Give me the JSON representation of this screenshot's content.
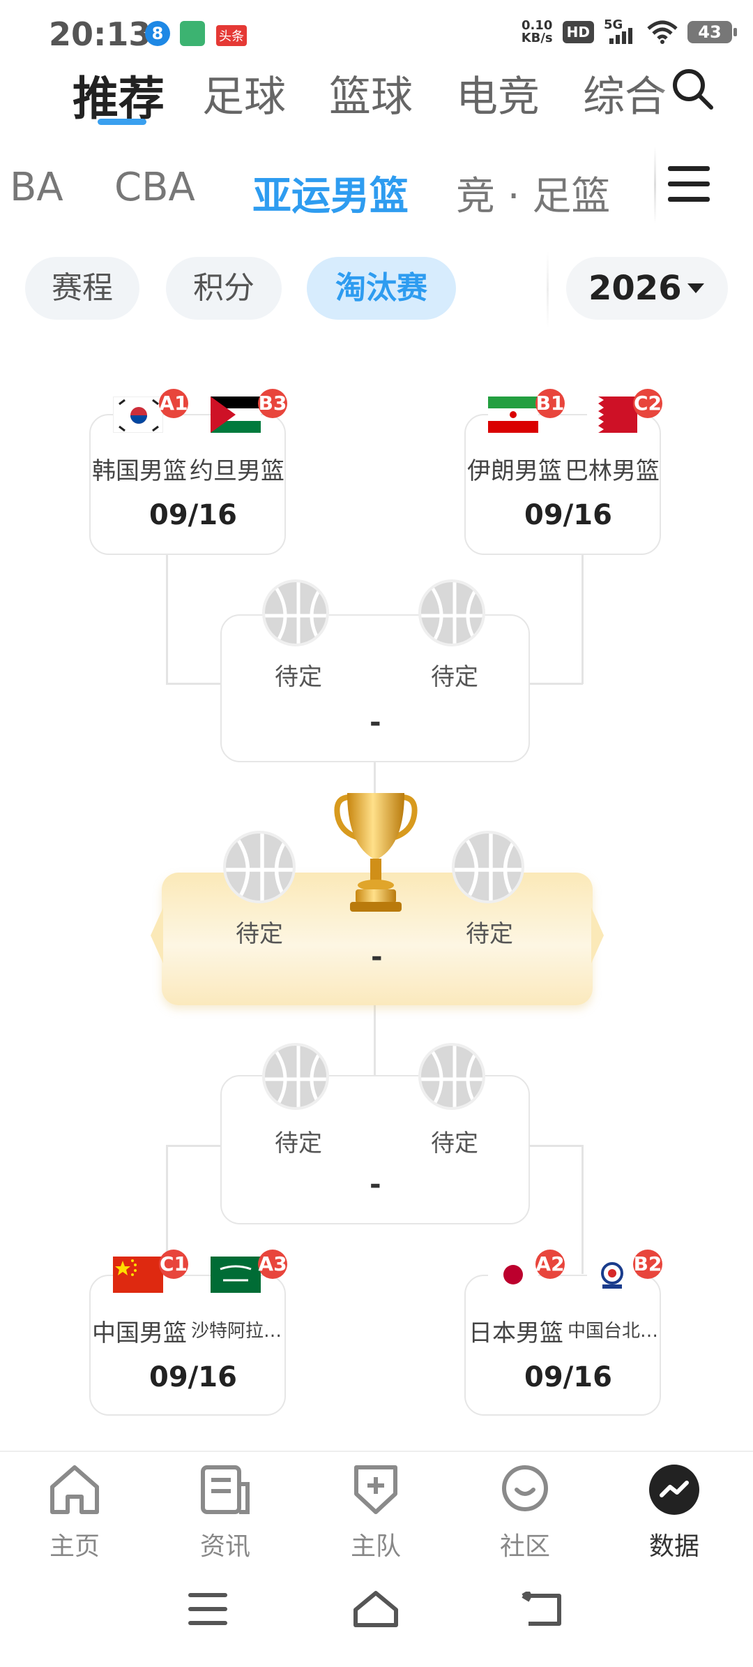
{
  "status_bar": {
    "time": "20:13",
    "net_speed": "0.10",
    "net_unit": "KB/s",
    "hd": "HD",
    "signal": "5G",
    "battery": "43",
    "app_badge": "头条"
  },
  "top_nav": {
    "tabs": [
      "推荐",
      "足球",
      "篮球",
      "电竞",
      "综合"
    ],
    "active": "推荐"
  },
  "league_nav": {
    "tabs": [
      "BA",
      "CBA",
      "亚运男篮",
      "竞 · 足篮"
    ],
    "active": "亚运男篮"
  },
  "filters": {
    "items": [
      "赛程",
      "积分",
      "淘汰赛"
    ],
    "active": "淘汰赛",
    "year": "2026"
  },
  "bracket": {
    "top_left": {
      "team1": "韩国男篮",
      "seed1": "A1",
      "team2": "约旦男篮",
      "seed2": "B3",
      "date": "09/16"
    },
    "top_right": {
      "team1": "伊朗男篮",
      "seed1": "B1",
      "team2": "巴林男篮",
      "seed2": "C2",
      "date": "09/16"
    },
    "semi_top": {
      "team1": "待定",
      "team2": "待定",
      "score": "-"
    },
    "final": {
      "team1": "待定",
      "team2": "待定",
      "score": "-"
    },
    "semi_bottom": {
      "team1": "待定",
      "team2": "待定",
      "score": "-"
    },
    "bottom_left": {
      "team1": "中国男篮",
      "seed1": "C1",
      "team2": "沙特阿拉…",
      "seed2": "A3",
      "date": "09/16"
    },
    "bottom_right": {
      "team1": "日本男篮",
      "seed1": "A2",
      "team2": "中国台北…",
      "seed2": "B2",
      "date": "09/16"
    }
  },
  "bottom_tabs": {
    "items": [
      "主页",
      "资讯",
      "主队",
      "社区",
      "数据"
    ],
    "active": "数据"
  },
  "colors": {
    "accent": "#2e9cf0",
    "seed_badge": "#e8453c",
    "final_bg": "#fbe9b8"
  }
}
